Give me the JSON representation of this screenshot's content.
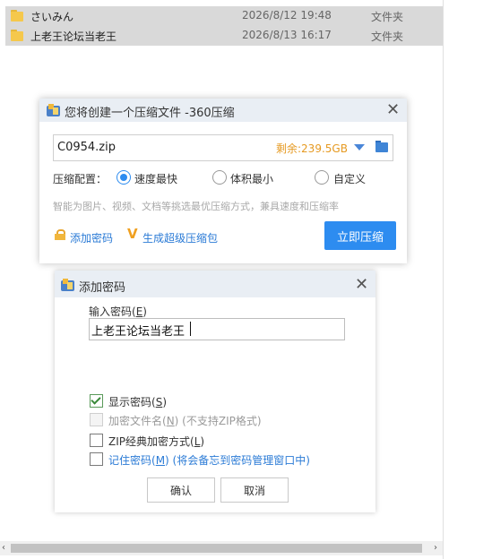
{
  "explorer": {
    "files": [
      {
        "name": "さいみん",
        "date": "2026/8/12 19:48",
        "type": "文件夹"
      },
      {
        "name": "上老王论坛当老王",
        "date": "2026/8/13 16:17",
        "type": "文件夹"
      }
    ],
    "scroll_left": "‹",
    "scroll_right": "›"
  },
  "compress_dialog": {
    "title": "您将创建一个压缩文件 -360压缩",
    "close": "✕",
    "filename": "C0954.zip",
    "free_space": "剩余:239.5GB",
    "config_label": "压缩配置：",
    "options": [
      "速度最快",
      "体积最小",
      "自定义"
    ],
    "selected_option": "速度最快",
    "hint": "智能为图片、视频、文档等挑选最优压缩方式，兼具速度和压缩率",
    "add_password_link": "添加密码",
    "super_link_v": "V",
    "super_link": "生成超级压缩包",
    "compress_button": "立即压缩"
  },
  "password_dialog": {
    "title": "添加密码",
    "close": "✕",
    "input_label_prefix": "输入密码(",
    "input_label_key": "E",
    "input_label_suffix": ")",
    "password_value": "上老王论坛当老王",
    "show_password": {
      "prefix": "显示密码(",
      "key": "S",
      "suffix": ")",
      "checked": true
    },
    "encrypt_names": {
      "prefix": "加密文件名(",
      "key": "N",
      "suffix": ") (不支持ZIP格式)",
      "checked": false,
      "disabled": true
    },
    "zip_classic": {
      "prefix": "ZIP经典加密方式(",
      "key": "L",
      "suffix": ")",
      "checked": false
    },
    "remember": {
      "prefix": "记住密码(",
      "key": "M",
      "suffix": ") (将会备忘到密码管理窗口中)",
      "checked": false
    },
    "ok_button": "确认",
    "cancel_button": "取消"
  },
  "colors": {
    "accent": "#2d8cf0",
    "space_orange": "#e69a22",
    "link_blue": "#2b7bd6",
    "folder_yellow": "#f5c84c"
  }
}
